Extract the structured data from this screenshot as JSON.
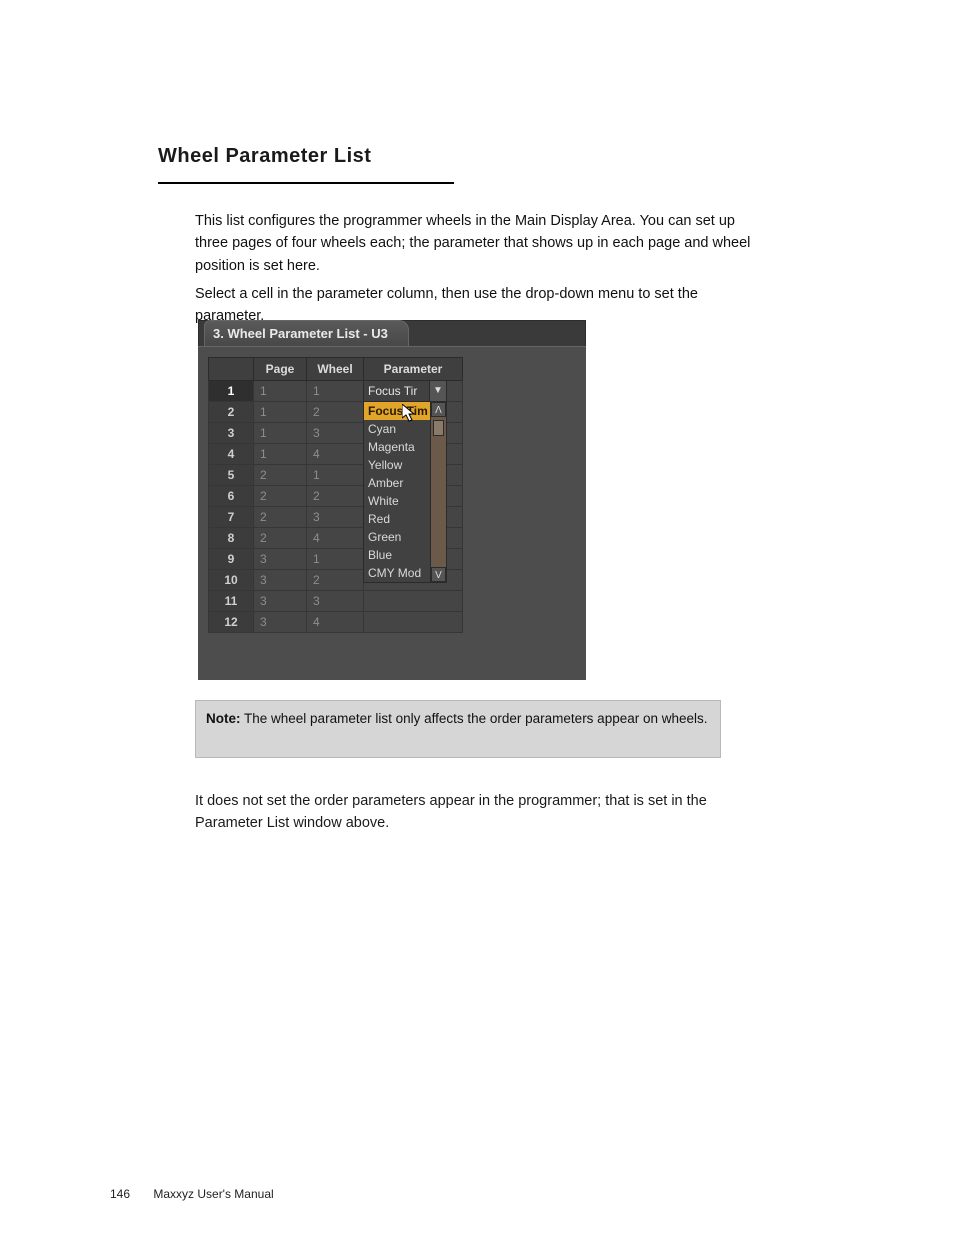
{
  "section_heading": "Wheel Parameter List",
  "paragraph1": "This list configures the programmer wheels in the Main Display Area. You can set up three pages of four wheels each; the parameter that shows up in each page and wheel position is set here.",
  "paragraph2": "Select a cell in the parameter column, then use the drop-down menu to set the parameter.",
  "shot": {
    "tab_title": "3. Wheel Parameter List - U3",
    "headers": {
      "page": "Page",
      "wheel": "Wheel",
      "parameter": "Parameter"
    },
    "rows": [
      {
        "n": "1",
        "page": "1",
        "wheel": "1"
      },
      {
        "n": "2",
        "page": "1",
        "wheel": "2"
      },
      {
        "n": "3",
        "page": "1",
        "wheel": "3"
      },
      {
        "n": "4",
        "page": "1",
        "wheel": "4"
      },
      {
        "n": "5",
        "page": "2",
        "wheel": "1"
      },
      {
        "n": "6",
        "page": "2",
        "wheel": "2"
      },
      {
        "n": "7",
        "page": "2",
        "wheel": "3"
      },
      {
        "n": "8",
        "page": "2",
        "wheel": "4"
      },
      {
        "n": "9",
        "page": "3",
        "wheel": "1"
      },
      {
        "n": "10",
        "page": "3",
        "wheel": "2"
      },
      {
        "n": "11",
        "page": "3",
        "wheel": "3"
      },
      {
        "n": "12",
        "page": "3",
        "wheel": "4"
      }
    ],
    "dropdown": {
      "selected": "Focus Tir",
      "items": [
        "Focus Tim",
        "Cyan",
        "Magenta",
        "Yellow",
        "Amber",
        "White",
        "Red",
        "Green",
        "Blue",
        "CMY Mod"
      ],
      "highlight_index": 0,
      "scroll_up_glyph": "Λ",
      "scroll_down_glyph": "V",
      "tri_glyph": "▼"
    }
  },
  "note": {
    "label": "Note:",
    "text": "The wheel parameter list only affects the order parameters appear on wheels."
  },
  "footer_paragraph": "It does not set the order parameters appear in the programmer; that is set in the Parameter List window above.",
  "page_footer": {
    "number": "146",
    "title": "Maxxyz User's Manual"
  }
}
